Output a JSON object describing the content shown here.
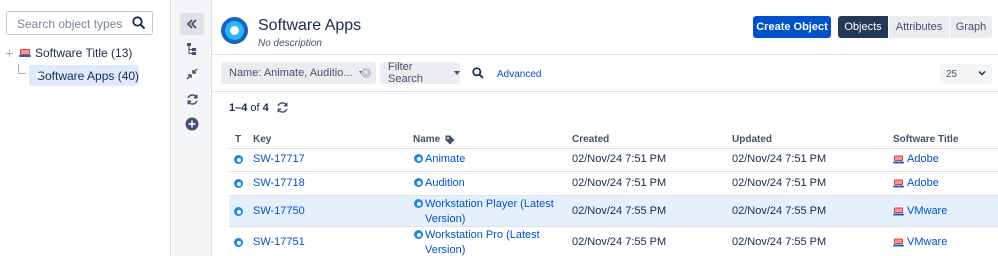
{
  "tree": {
    "search_placeholder": "Search object types",
    "items": [
      {
        "label": "Software Title (13)"
      },
      {
        "label": "Software Apps (40)"
      }
    ]
  },
  "header": {
    "title": "Software Apps",
    "subtitle": "No description",
    "create_label": "Create Object",
    "views": [
      "Objects",
      "Attributes",
      "Graph"
    ],
    "active_view": "Objects"
  },
  "filter": {
    "name_filter": "Name: Animate, Auditio...",
    "filter_search": "Filter Search",
    "advanced": "Advanced",
    "page_size": "25"
  },
  "results": {
    "range": "1–4",
    "of_word": "of",
    "total": "4"
  },
  "table": {
    "columns": {
      "type": "T",
      "key": "Key",
      "name": "Name",
      "created": "Created",
      "updated": "Updated",
      "software_title": "Software Title"
    },
    "rows": [
      {
        "key": "SW-17717",
        "name": "Animate",
        "created": "02/Nov/24 7:51 PM",
        "updated": "02/Nov/24 7:51 PM",
        "software_title": "Adobe"
      },
      {
        "key": "SW-17718",
        "name": "Audition",
        "created": "02/Nov/24 7:51 PM",
        "updated": "02/Nov/24 7:51 PM",
        "software_title": "Adobe"
      },
      {
        "key": "SW-17750",
        "name": "Workstation Player (Latest Version)",
        "created": "02/Nov/24 7:55 PM",
        "updated": "02/Nov/24 7:55 PM",
        "software_title": "VMware"
      },
      {
        "key": "SW-17751",
        "name": "Workstation Pro (Latest Version)",
        "created": "02/Nov/24 7:55 PM",
        "updated": "02/Nov/24 7:55 PM",
        "software_title": "VMware"
      }
    ]
  },
  "colors": {
    "accent": "#0052cc",
    "active_view_bg": "#253858",
    "selected_row": "#e6effc",
    "app_icon": "#1e88e5"
  }
}
